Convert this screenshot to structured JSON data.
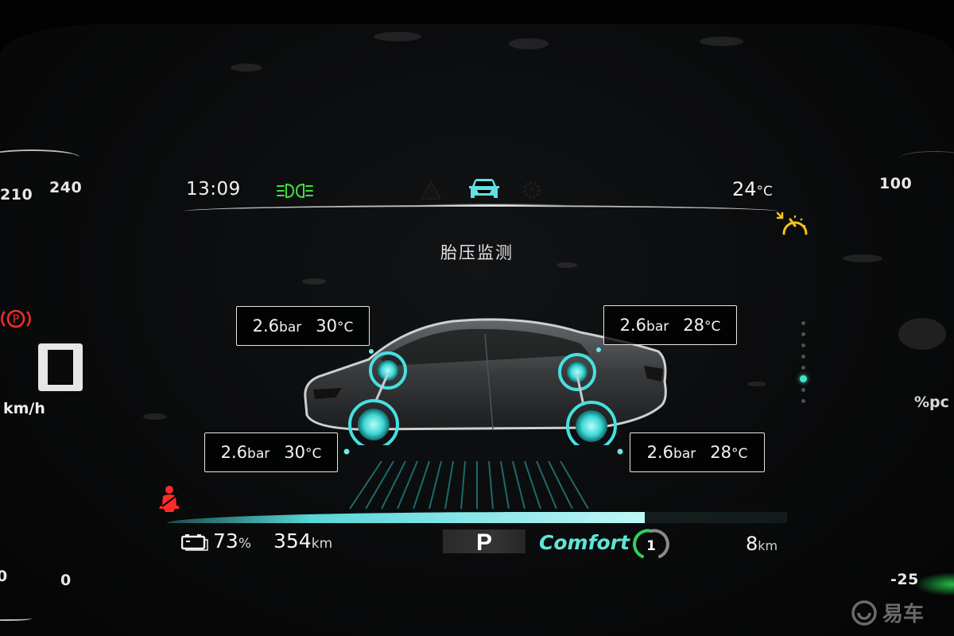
{
  "header": {
    "time": "13:09",
    "outside_temp_value": "24",
    "outside_temp_unit": "°C",
    "icons": [
      "headlight-icon",
      "warning-triangle-icon",
      "car-front-icon",
      "gear-settings-icon"
    ]
  },
  "page_title": "胎压监测",
  "tires": {
    "front_left": {
      "pressure": "2.6",
      "pressure_unit": "bar",
      "temp": "30",
      "temp_unit": "°C"
    },
    "front_right": {
      "pressure": "2.6",
      "pressure_unit": "bar",
      "temp": "28",
      "temp_unit": "°C"
    },
    "rear_left": {
      "pressure": "2.6",
      "pressure_unit": "bar",
      "temp": "30",
      "temp_unit": "°C"
    },
    "rear_right": {
      "pressure": "2.6",
      "pressure_unit": "bar",
      "temp": "28",
      "temp_unit": "°C"
    }
  },
  "speedometer": {
    "ticks": [
      "210",
      "240",
      "0",
      "0"
    ],
    "speed": "0",
    "unit": "km/h"
  },
  "power_meter": {
    "ticks": [
      "100",
      "-25"
    ],
    "unit": "%pc"
  },
  "status_bar": {
    "battery_value": "73",
    "battery_unit": "%",
    "range_value": "354",
    "range_unit": "km",
    "gear": "P",
    "drive_mode": "Comfort",
    "regen_level": "1",
    "trip_value": "8",
    "trip_unit": "km",
    "progress_fraction": 0.77
  },
  "colors": {
    "accent_cyan": "#58d6d8",
    "drive_mode": "#5fe6d6",
    "headlight_green": "#3fe03f",
    "warning_red": "#ff2a2a",
    "cruise_yellow": "#f5c41a",
    "regen_green": "#2fd15a"
  },
  "watermark": "易车"
}
